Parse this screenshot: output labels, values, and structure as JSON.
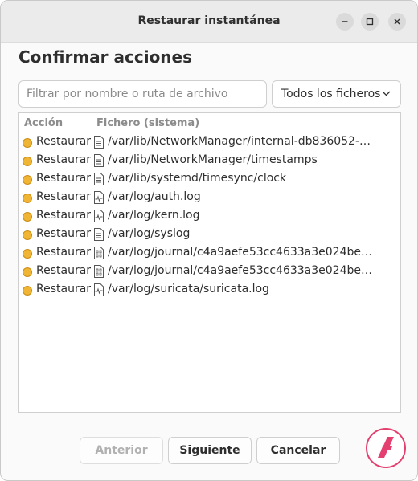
{
  "window": {
    "title": "Restaurar instantánea"
  },
  "heading": "Confirmar acciones",
  "filter": {
    "placeholder": "Filtrar por nombre o ruta de archivo",
    "value": ""
  },
  "file_type_select": {
    "selected": "Todos los ficheros"
  },
  "table": {
    "columns": [
      "Acción",
      "Fichero (sistema)"
    ],
    "rows": [
      {
        "action": "Restaurar",
        "path": "/var/lib/NetworkManager/internal-db836052-b…",
        "icon": "text-file-icon"
      },
      {
        "action": "Restaurar",
        "path": "/var/lib/NetworkManager/timestamps",
        "icon": "text-file-icon"
      },
      {
        "action": "Restaurar",
        "path": "/var/lib/systemd/timesync/clock",
        "icon": "text-file-icon"
      },
      {
        "action": "Restaurar",
        "path": "/var/log/auth.log",
        "icon": "log-file-icon"
      },
      {
        "action": "Restaurar",
        "path": "/var/log/kern.log",
        "icon": "log-file-icon"
      },
      {
        "action": "Restaurar",
        "path": "/var/log/syslog",
        "icon": "text-file-icon"
      },
      {
        "action": "Restaurar",
        "path": "/var/log/journal/c4a9aefe53cc4633a3e024becc…",
        "icon": "binary-file-icon"
      },
      {
        "action": "Restaurar",
        "path": "/var/log/journal/c4a9aefe53cc4633a3e024becc…",
        "icon": "binary-file-icon"
      },
      {
        "action": "Restaurar",
        "path": "/var/log/suricata/suricata.log",
        "icon": "log-file-icon"
      }
    ]
  },
  "buttons": {
    "prev": "Anterior",
    "next": "Siguiente",
    "cancel": "Cancelar"
  },
  "colors": {
    "status_dot": "#f0b534",
    "logo": "#e4406f"
  }
}
